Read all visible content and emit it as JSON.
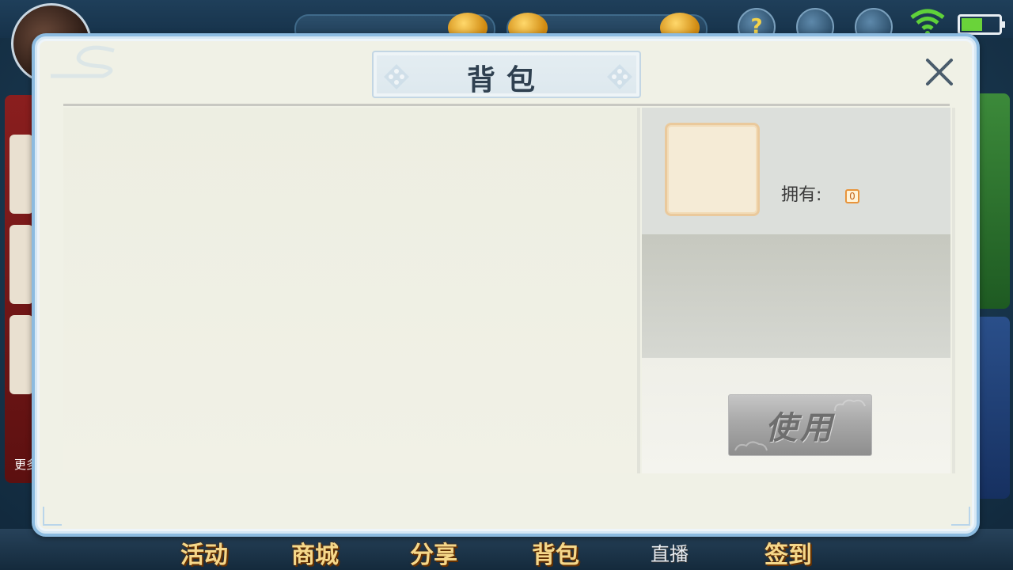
{
  "dialog": {
    "title": "背包",
    "owned_label": "拥有:",
    "owned_count": "0",
    "use_label": "使用"
  },
  "lobby": {
    "left_more": "更多",
    "nav": [
      {
        "label": "活动"
      },
      {
        "label": "商城"
      },
      {
        "label": "分享"
      },
      {
        "label": "背包"
      },
      {
        "label": "直播"
      },
      {
        "label": "签到"
      }
    ],
    "help_glyph": "?"
  },
  "colors": {
    "dialog_bg": "#f0f1e6",
    "dialog_border": "#8cbbe0",
    "title_text": "#2f4050",
    "nav_gold": "#f6d88a",
    "use_button_gray": "#a8a8a8"
  },
  "icons": [
    "avatar",
    "help-icon",
    "mail-icon",
    "gear-icon",
    "wifi-icon",
    "battery-icon",
    "close-icon",
    "dice-ornament-icon",
    "cloud-ornament-icon"
  ]
}
